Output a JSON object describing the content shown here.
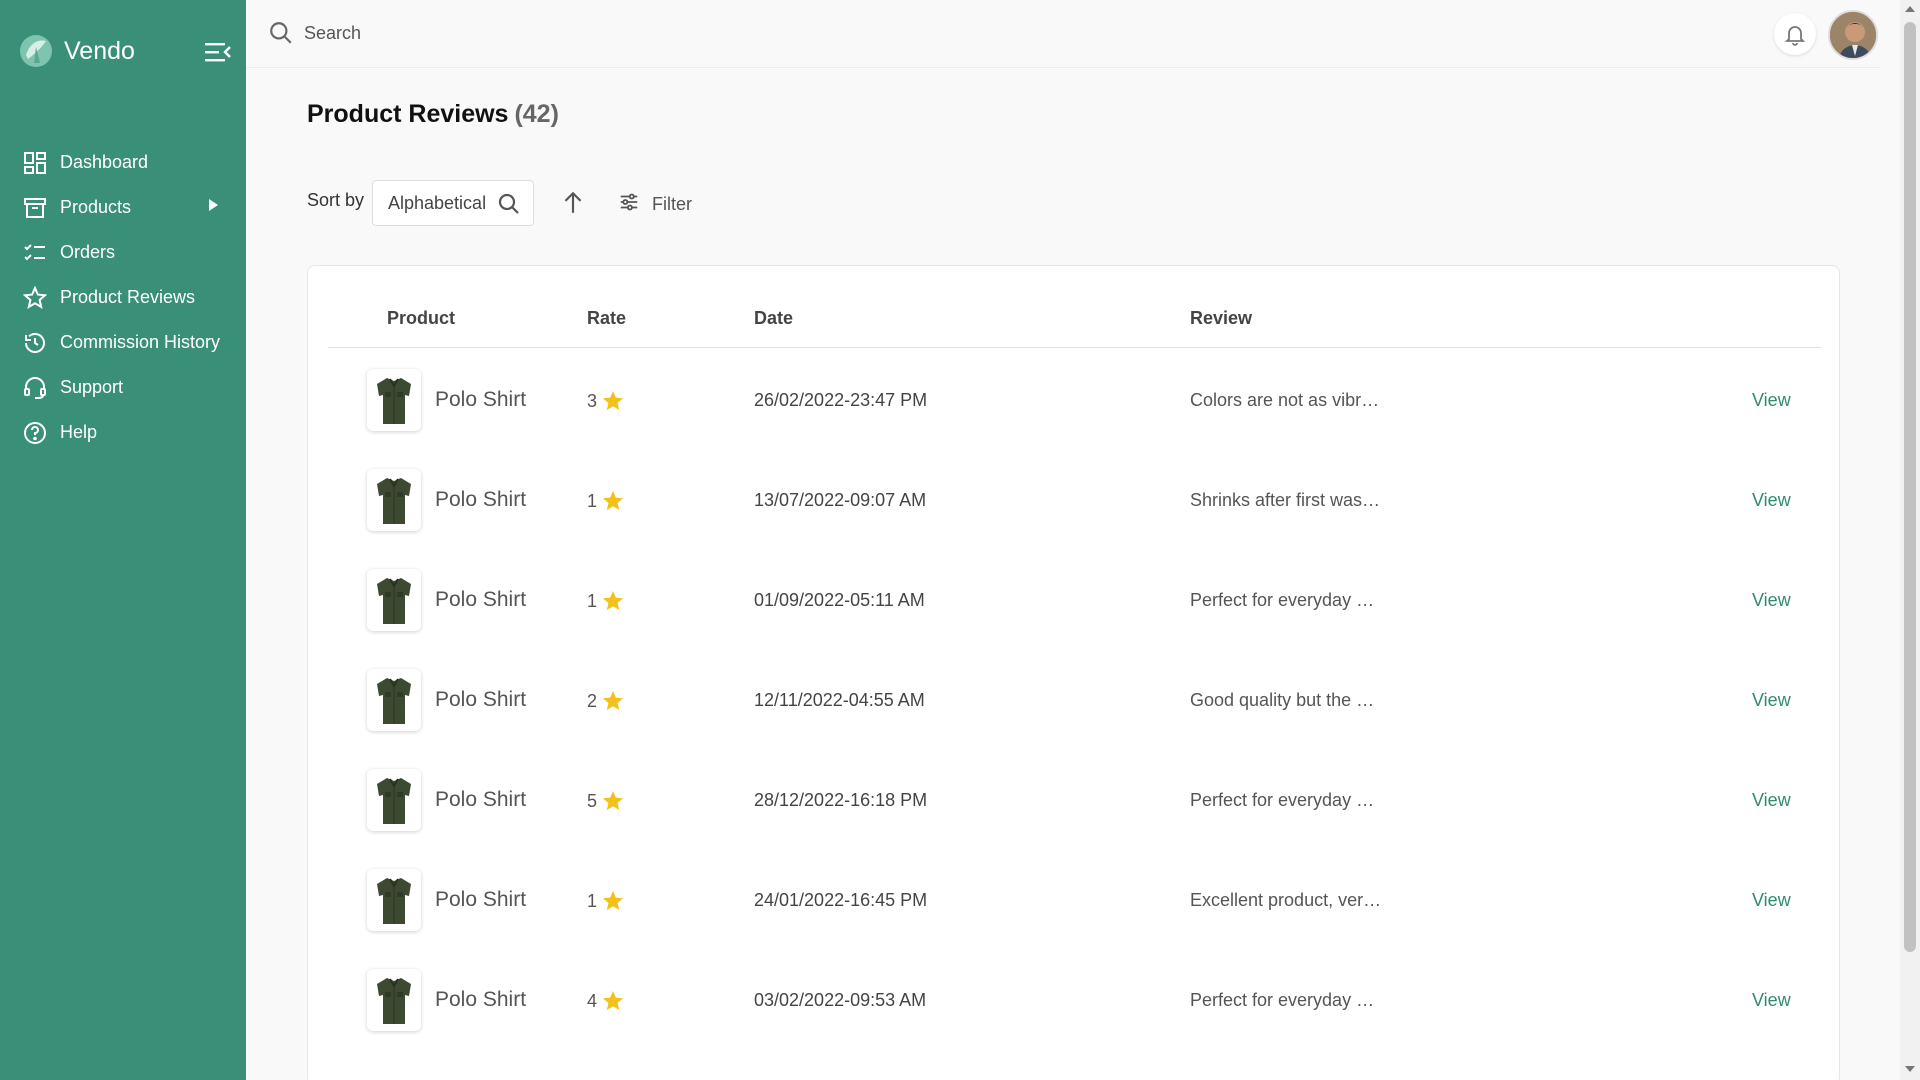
{
  "brand": {
    "name": "Vendo",
    "color": "#3a8f78"
  },
  "sidebar": {
    "items": [
      {
        "label": "Dashboard",
        "icon": "dashboard-icon"
      },
      {
        "label": "Products",
        "icon": "box-icon",
        "has_submenu": true
      },
      {
        "label": "Orders",
        "icon": "checklist-icon"
      },
      {
        "label": "Product Reviews",
        "icon": "star-outline-icon"
      },
      {
        "label": "Commission History",
        "icon": "history-icon"
      },
      {
        "label": "Support",
        "icon": "headset-icon"
      },
      {
        "label": "Help",
        "icon": "question-circle-icon"
      }
    ]
  },
  "topbar": {
    "search_placeholder": "Search"
  },
  "page": {
    "title": "Product Reviews",
    "count": "(42)"
  },
  "toolbar": {
    "sort_label": "Sort by",
    "sort_value": "Alphabetical",
    "filter_label": "Filter"
  },
  "table": {
    "columns": [
      "Product",
      "Rate",
      "Date",
      "Review"
    ],
    "rows": [
      {
        "product": "Polo Shirt",
        "rate": "3",
        "date": "26/02/2022-23:47 PM",
        "review": "Colors are not as vibr…",
        "action": "View"
      },
      {
        "product": "Polo Shirt",
        "rate": "1",
        "date": "13/07/2022-09:07 AM",
        "review": "Shrinks after first was…",
        "action": "View"
      },
      {
        "product": "Polo Shirt",
        "rate": "1",
        "date": "01/09/2022-05:11 AM",
        "review": "Perfect for everyday …",
        "action": "View"
      },
      {
        "product": "Polo Shirt",
        "rate": "2",
        "date": "12/11/2022-04:55 AM",
        "review": "Good quality but the …",
        "action": "View"
      },
      {
        "product": "Polo Shirt",
        "rate": "5",
        "date": "28/12/2022-16:18 PM",
        "review": "Perfect for everyday …",
        "action": "View"
      },
      {
        "product": "Polo Shirt",
        "rate": "1",
        "date": "24/01/2022-16:45 PM",
        "review": "Excellent product, ver…",
        "action": "View"
      },
      {
        "product": "Polo Shirt",
        "rate": "4",
        "date": "03/02/2022-09:53 AM",
        "review": "Perfect for everyday …",
        "action": "View"
      }
    ]
  },
  "colors": {
    "accent": "#3a8f78",
    "star": "#f2c21b",
    "link": "#2f8a70"
  }
}
